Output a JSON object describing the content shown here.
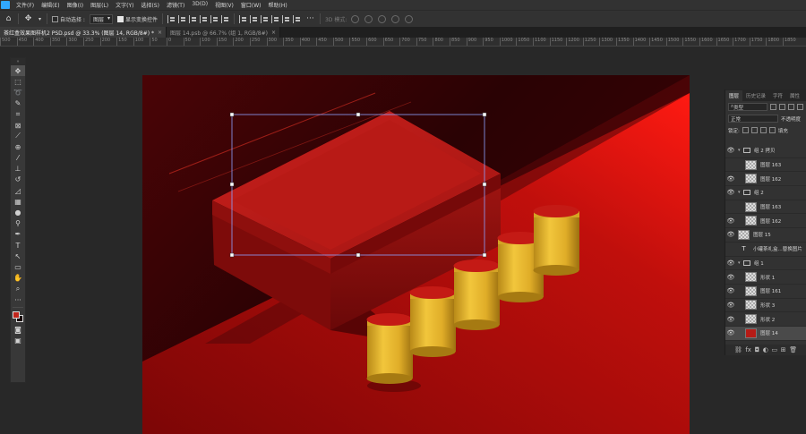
{
  "menubar": {
    "items": [
      "文件(F)",
      "编辑(E)",
      "图像(I)",
      "图层(L)",
      "文字(Y)",
      "选择(S)",
      "滤镜(T)",
      "3D(D)",
      "视图(V)",
      "窗口(W)",
      "帮助(H)"
    ]
  },
  "optbar": {
    "auto_select_label": "自动选择 :",
    "auto_select_target": "图层",
    "show_transform_label": "显示变换控件",
    "mode_3d_label": "3D 模式:"
  },
  "tabs": [
    {
      "label": "茶红盒效果图样机2 PSD.psd @ 33.3% (图层 14, RGB/8#) *"
    },
    {
      "label": "图层 14.psb @ 66.7% (组 1, RGB/8#)"
    }
  ],
  "ruler": {
    "labels": [
      "500",
      "450",
      "400",
      "350",
      "300",
      "250",
      "200",
      "150",
      "100",
      "50",
      "0",
      "50",
      "100",
      "150",
      "200",
      "250",
      "300",
      "350",
      "400",
      "450",
      "500",
      "550",
      "600",
      "650",
      "700",
      "750",
      "800",
      "850",
      "900",
      "950",
      "1000",
      "1050",
      "1100",
      "1150",
      "1200",
      "1250",
      "1300",
      "1350",
      "1400",
      "1450",
      "1500",
      "1550",
      "1600",
      "1650",
      "1700",
      "1750",
      "1800",
      "1850"
    ]
  },
  "toolbar": {
    "head": "»"
  },
  "layers_panel": {
    "tabs": [
      "图层",
      "历史记录",
      "字符",
      "属性"
    ],
    "filter_kind": "类型",
    "blend_mode": "正常",
    "opacity_label": "不透明度",
    "lock_label": "锁定:",
    "fill_label": "填充",
    "layers": [
      {
        "name": "组 2 拷贝",
        "type": "group",
        "indent": 0,
        "visible": true
      },
      {
        "name": "图层 163",
        "type": "pixel",
        "indent": 2,
        "visible": false
      },
      {
        "name": "图层 162",
        "type": "pixel",
        "indent": 2,
        "visible": true
      },
      {
        "name": "组 2",
        "type": "group",
        "indent": 0,
        "visible": true
      },
      {
        "name": "图层 163",
        "type": "pixel",
        "indent": 2,
        "visible": false
      },
      {
        "name": "图层 162",
        "type": "pixel",
        "indent": 2,
        "visible": true
      },
      {
        "name": "图层 15",
        "type": "pixel",
        "indent": 0,
        "visible": true
      },
      {
        "name": "小罐茶礼盒...替换图片",
        "type": "text",
        "indent": 0,
        "visible": false
      },
      {
        "name": "组 1",
        "type": "group",
        "indent": 0,
        "visible": true
      },
      {
        "name": "形状 1",
        "type": "pixel",
        "indent": 2,
        "visible": true
      },
      {
        "name": "图层 161",
        "type": "pixel",
        "indent": 2,
        "visible": true
      },
      {
        "name": "形状 3",
        "type": "pixel",
        "indent": 2,
        "visible": true
      },
      {
        "name": "形状 2",
        "type": "pixel",
        "indent": 2,
        "visible": true
      },
      {
        "name": "图层 14",
        "type": "red",
        "indent": 2,
        "visible": true,
        "selected": true
      }
    ]
  },
  "colors": {
    "accent": "#31a8ff",
    "foreground": "#c0261c",
    "background": "#1a0707"
  }
}
